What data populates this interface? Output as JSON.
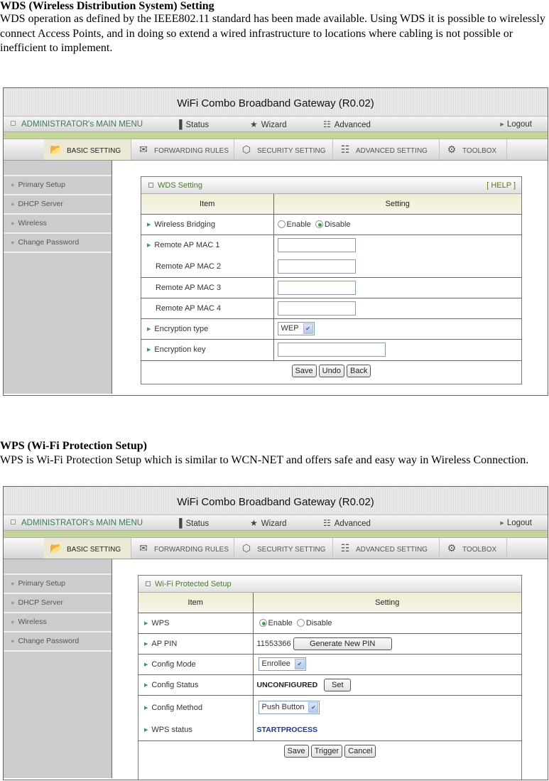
{
  "wds_section": {
    "heading": "WDS (Wireless Distribution System) Setting",
    "description": "WDS operation as defined by the IEEE802.11 standard has been made available. Using WDS it is possible to wirelessly connect Access Points, and in doing so extend a wired infrastructure to locations where cabling is not possible or inefficient to implement."
  },
  "wps_section": {
    "heading": "WPS (Wi-Fi Protection Setup)",
    "description": "WPS is Wi-Fi Protection Setup which is similar to WCN-NET and offers safe and easy way in Wireless Connection."
  },
  "router_ui": {
    "title": "WiFi Combo Broadband Gateway (R0.02)",
    "main_menu_label": "ADMINISTRATOR's MAIN MENU",
    "menu": [
      {
        "label": "Status",
        "icon": "status-icon"
      },
      {
        "label": "Wizard",
        "icon": "wizard-icon"
      },
      {
        "label": "Advanced",
        "icon": "advanced-icon"
      }
    ],
    "logout_label": "Logout",
    "tabs": [
      {
        "label": "BASIC SETTING",
        "icon": "folder-icon",
        "active": true
      },
      {
        "label": "FORWARDING RULES",
        "icon": "forwarding-icon"
      },
      {
        "label": "SECURITY SETTING",
        "icon": "security-icon"
      },
      {
        "label": "ADVANCED SETTING",
        "icon": "advanced-setting-icon"
      },
      {
        "label": "TOOLBOX",
        "icon": "toolbox-icon"
      }
    ],
    "sidebar": [
      "Primary Setup",
      "DHCP Server",
      "Wireless",
      "Change Password"
    ]
  },
  "wds_panel": {
    "title": "WDS Setting",
    "help_label": "[ HELP ]",
    "col_item": "Item",
    "col_setting": "Setting",
    "wireless_bridging": {
      "label": "Wireless Bridging",
      "options": [
        "Enable",
        "Disable"
      ],
      "selected": "Disable"
    },
    "mac_rows": [
      {
        "label": "Remote AP MAC 1",
        "value": ""
      },
      {
        "label": "Remote AP MAC 2",
        "value": ""
      },
      {
        "label": "Remote AP MAC 3",
        "value": ""
      },
      {
        "label": "Remote AP MAC 4",
        "value": ""
      }
    ],
    "encryption_type": {
      "label": "Encryption type",
      "value": "WEP"
    },
    "encryption_key": {
      "label": "Encryption key",
      "value": ""
    },
    "buttons": {
      "save": "Save",
      "undo": "Undo",
      "back": "Back"
    }
  },
  "wps_panel": {
    "title": "Wi-Fi Protected Setup",
    "col_item": "Item",
    "col_setting": "Setting",
    "wps": {
      "label": "WPS",
      "options": [
        "Enable",
        "Disable"
      ],
      "selected": "Enable"
    },
    "ap_pin": {
      "label": "AP PIN",
      "value": "11553366",
      "button": "Generate New PIN"
    },
    "config_mode": {
      "label": "Config Mode",
      "value": "Enrollee"
    },
    "config_status": {
      "label": "Config Status",
      "value": "UNCONFIGURED",
      "button": "Set"
    },
    "config_method": {
      "label": "Config Method",
      "value": "Push Button"
    },
    "wps_status": {
      "label": "WPS status",
      "value": "STARTPROCESS"
    },
    "buttons": {
      "save": "Save",
      "trigger": "Trigger",
      "cancel": "Cancel"
    }
  }
}
